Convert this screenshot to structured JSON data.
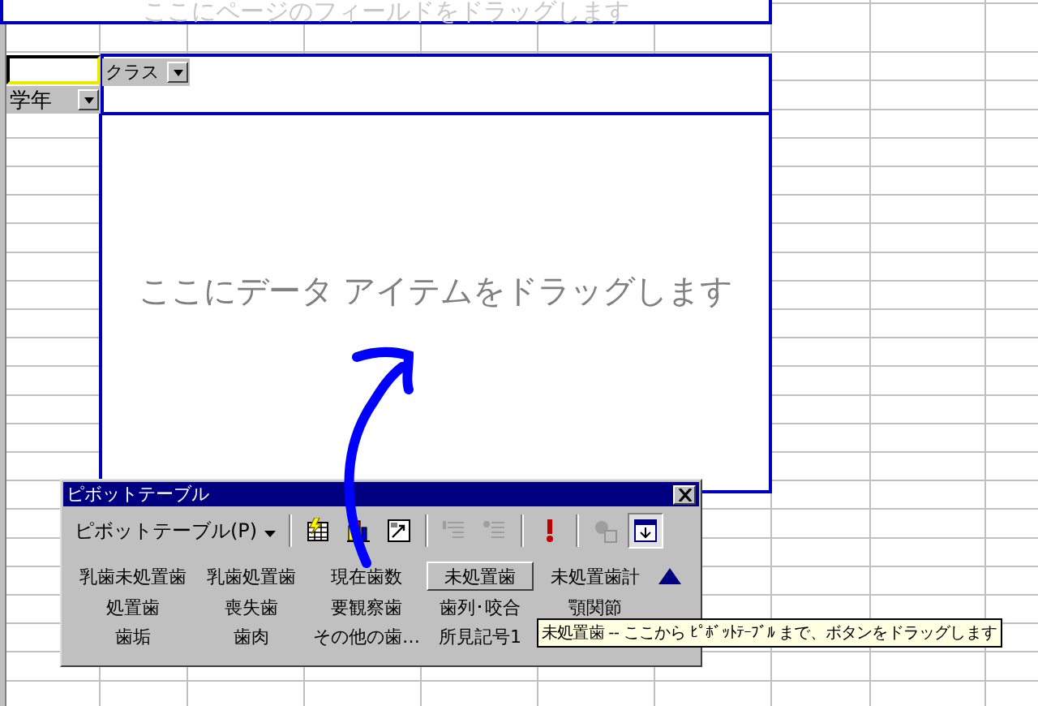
{
  "page_area": {
    "hint": "ここにページのフィールドをドラッグします"
  },
  "column_field": {
    "label": "クラス"
  },
  "row_field": {
    "label": "学年"
  },
  "data_area": {
    "hint": "ここにデータ アイテムをドラッグします"
  },
  "toolbar": {
    "title": "ピボットテーブル",
    "menu": "ピボットテーブル(P)",
    "tools": [
      {
        "kind": "separator"
      },
      {
        "kind": "wizard",
        "disabled": false,
        "pressed": false
      },
      {
        "kind": "chart",
        "disabled": false,
        "pressed": false
      },
      {
        "kind": "field",
        "disabled": false,
        "pressed": false
      },
      {
        "kind": "separator"
      },
      {
        "kind": "hide-detail",
        "disabled": true,
        "pressed": false
      },
      {
        "kind": "show-detail",
        "disabled": true,
        "pressed": false
      },
      {
        "kind": "separator"
      },
      {
        "kind": "refresh",
        "disabled": false,
        "pressed": false
      },
      {
        "kind": "separator"
      },
      {
        "kind": "select",
        "disabled": true,
        "pressed": false
      },
      {
        "kind": "display-fields",
        "disabled": false,
        "pressed": true
      }
    ],
    "fields": [
      [
        {
          "label": "乳歯未処置歯",
          "selected": false
        },
        {
          "label": "乳歯処置歯",
          "selected": false
        },
        {
          "label": "現在歯数",
          "selected": false
        },
        {
          "label": "未処置歯",
          "selected": true
        },
        {
          "label": "未処置歯計",
          "selected": false
        }
      ],
      [
        {
          "label": "処置歯",
          "selected": false
        },
        {
          "label": "喪失歯",
          "selected": false
        },
        {
          "label": "要観察歯",
          "selected": false
        },
        {
          "label": "歯列･咬合",
          "selected": false
        },
        {
          "label": "顎関節",
          "selected": false
        }
      ],
      [
        {
          "label": "歯垢",
          "selected": false
        },
        {
          "label": "歯肉",
          "selected": false
        },
        {
          "label": "その他の歯…",
          "selected": false
        },
        {
          "label": "所見記号1",
          "selected": false
        }
      ]
    ]
  },
  "tooltip": "未処置歯 -- ここから ﾋﾟﾎﾞｯﾄﾃｰﾌﾞﾙ まで、ボタンをドラッグします"
}
